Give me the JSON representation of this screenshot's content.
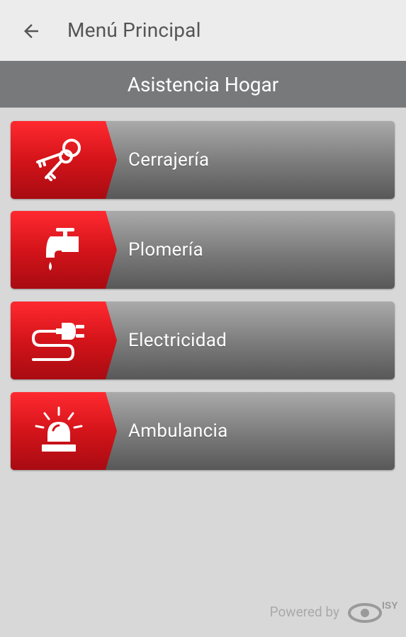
{
  "appbar": {
    "title": "Menú Principal",
    "back_icon": "arrow-left-icon"
  },
  "section": {
    "title": "Asistencia Hogar"
  },
  "menu": [
    {
      "label": "Cerrajería",
      "icon": "keys-icon"
    },
    {
      "label": "Plomería",
      "icon": "faucet-icon"
    },
    {
      "label": "Electricidad",
      "icon": "plug-icon"
    },
    {
      "label": "Ambulancia",
      "icon": "siren-icon"
    }
  ],
  "footer": {
    "powered_by": "Powered by",
    "logo_text": "ISY"
  },
  "colors": {
    "accent": "#d4141a",
    "header_bar": "#77797b",
    "background": "#d8d8d8"
  }
}
